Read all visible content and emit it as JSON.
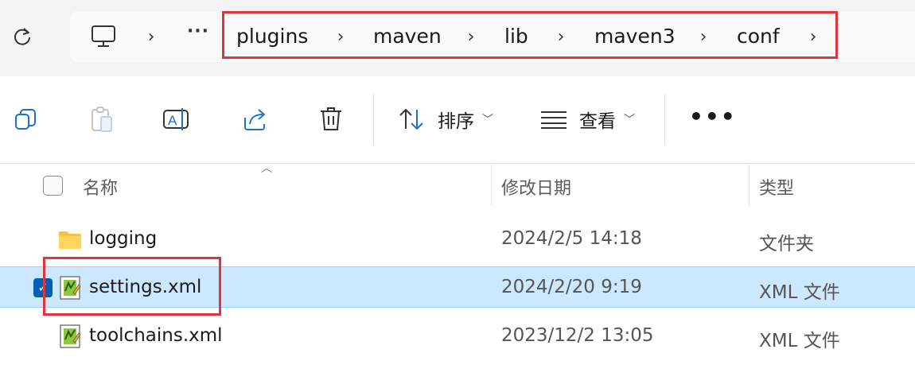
{
  "address": {
    "overflow_label": "···",
    "crumbs": [
      "plugins",
      "maven",
      "lib",
      "maven3",
      "conf"
    ]
  },
  "toolbar": {
    "sort_label": "排序",
    "view_label": "查看",
    "more_label": "•••"
  },
  "columns": {
    "name": "名称",
    "modified": "修改日期",
    "type": "类型"
  },
  "files": [
    {
      "name": "logging",
      "modified": "2024/2/5 14:18",
      "type": "文件夹",
      "icon": "folder-icon",
      "selected": false
    },
    {
      "name": "settings.xml",
      "modified": "2024/2/20 9:19",
      "type": "XML 文件",
      "icon": "xml-file-icon",
      "selected": true
    },
    {
      "name": "toolchains.xml",
      "modified": "2023/12/2 13:05",
      "type": "XML 文件",
      "icon": "xml-file-icon",
      "selected": false
    }
  ],
  "colors": {
    "highlight_box": "#e0343e",
    "selection_bg": "#cce8ff",
    "checkbox_accent": "#005fb8"
  }
}
